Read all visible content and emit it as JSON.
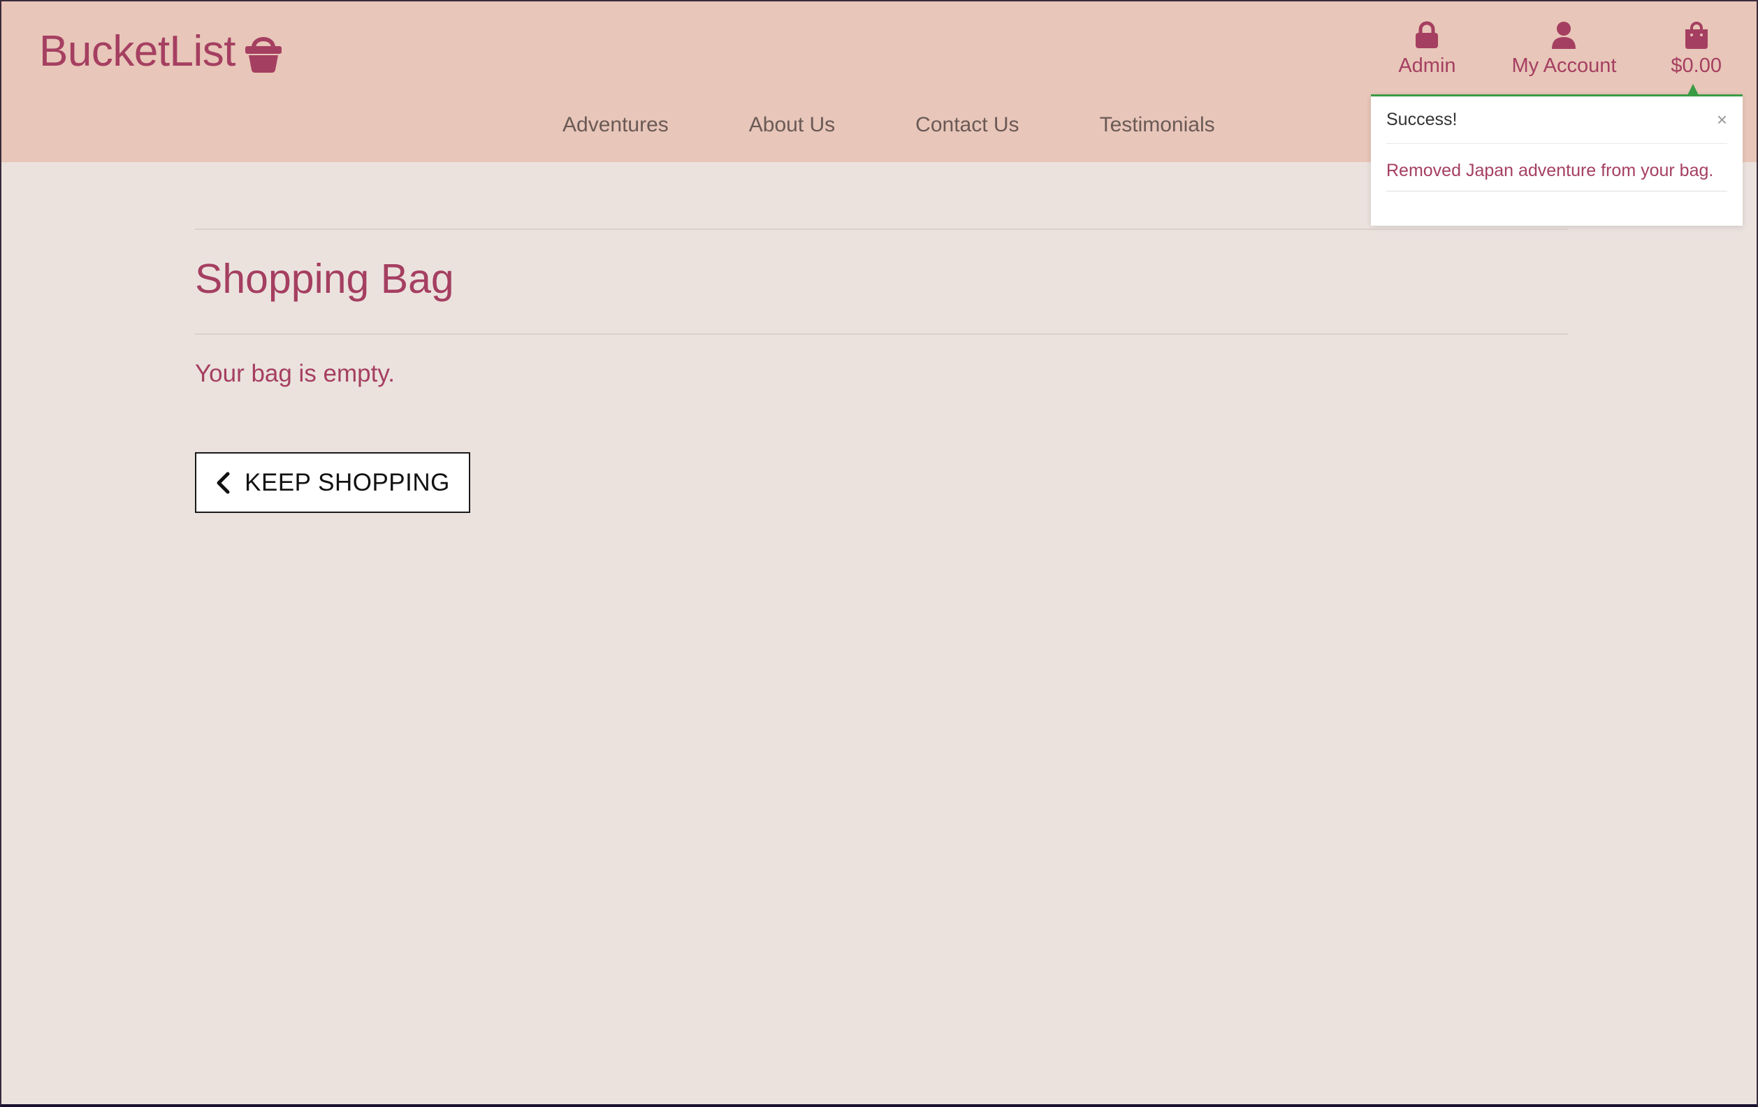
{
  "brand": {
    "name": "BucketList",
    "icon": "basket-icon",
    "color": "#a53f61"
  },
  "top_nav": {
    "admin": {
      "label": "Admin",
      "icon": "lock-icon"
    },
    "account": {
      "label": "My Account",
      "icon": "user-icon"
    },
    "bag": {
      "label": "$0.00",
      "icon": "shopping-bag-icon"
    }
  },
  "main_nav": {
    "items": [
      {
        "label": "Adventures"
      },
      {
        "label": "About Us"
      },
      {
        "label": "Contact Us"
      },
      {
        "label": "Testimonials"
      }
    ]
  },
  "toast": {
    "title": "Success!",
    "close": "×",
    "message": "Removed Japan adventure from your bag.",
    "accent": "#3a9b45"
  },
  "page": {
    "title": "Shopping Bag",
    "empty_message": "Your bag is empty.",
    "keep_shopping_label": "KEEP SHOPPING",
    "keep_shopping_icon": "chevron-left-icon"
  },
  "colors": {
    "header_bg": "#e8c6b9",
    "page_bg": "#ebe2de",
    "accent": "#a53f61"
  }
}
